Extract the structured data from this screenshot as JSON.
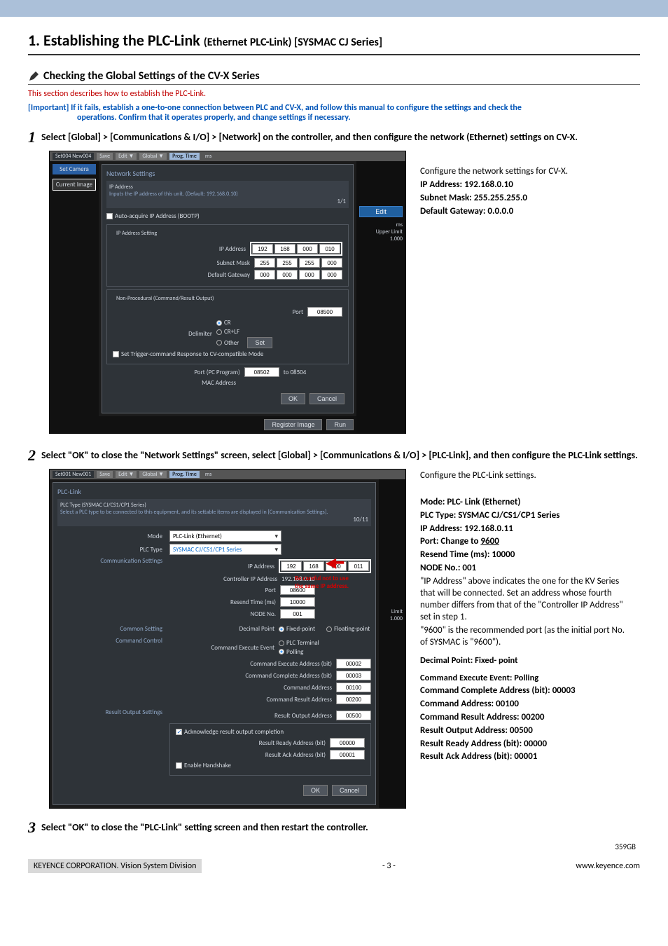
{
  "header": {
    "title_main": "1. Establishing the PLC-Link ",
    "title_sub": "(Ethernet PLC-Link) [SYSMAC CJ Series]"
  },
  "section": {
    "subtitle": "Checking the Global Settings of the CV-X Series",
    "desc": "This section describes how to establish the PLC-Link.",
    "important_a": "[Important] If it fails, establish a one-to-one connection between PLC and CV-X, and follow this manual to configure the settings and check the",
    "important_b": "operations. Confirm that it operates properly, and change settings if necessary."
  },
  "step1": {
    "num": "1",
    "text": "Select [Global] > [Communications & I/O] > [Network] on the controller, and then configure the network (Ethernet) settings on CV-X.",
    "notes": {
      "intro": "Configure the network settings for CV-X.",
      "ip": "IP Address: 192.168.0.10",
      "mask": "Subnet Mask: 255.255.255.0",
      "gw": "Default Gateway: 0.0.0.0"
    },
    "shot": {
      "topbar": {
        "set": "Set004 New004",
        "save": "Save",
        "edit": "Edit ▼",
        "global": "Global ▼",
        "prog": "Prog. Time",
        "ms": "ms"
      },
      "left": {
        "set_camera": "Set Camera",
        "current_image": "Current Image"
      },
      "panel_title": "Network Settings",
      "ip_hdr": "IP Address",
      "ip_hint": "Inputs the IP address of this unit. (Default: 192.168.0.10)",
      "counter": "1/1",
      "auto": "Auto-acquire IP Address (BOOTP)",
      "grp_ip": "IP Address Setting",
      "lbl_ip": "IP Address",
      "ip_vals": [
        "192",
        "168",
        "000",
        "010"
      ],
      "lbl_mask": "Subnet Mask",
      "mask_vals": [
        "255",
        "255",
        "255",
        "000"
      ],
      "lbl_gw": "Default Gateway",
      "gw_vals": [
        "000",
        "000",
        "000",
        "000"
      ],
      "grp_np": "Non-Procedural (Command/Result Output)",
      "lbl_port": "Port",
      "port": "08500",
      "lbl_delim": "Delimiter",
      "delim_cr": "CR",
      "delim_crlf": "CR+LF",
      "delim_other": "Other",
      "set_btn": "Set",
      "set_trigger": "Set Trigger-command Response to CV-compatible Mode",
      "lbl_portpc": "Port (PC Program)",
      "portpc_a": "08502",
      "portpc_to": "to 08504",
      "lbl_mac": "MAC Address",
      "ok": "OK",
      "cancel": "Cancel",
      "edit_btn": "Edit",
      "register": "Register Image",
      "run": "Run",
      "right": {
        "ms": "ms",
        "upper": "Upper Limit",
        "val": "1.000"
      }
    }
  },
  "step2": {
    "num": "2",
    "text": "Select \"OK\" to close the \"Network Settings\" screen, select [Global] > [Communications & I/O] > [PLC-Link], and then configure the PLC-Link settings.",
    "notes": {
      "intro": "Configure the PLC-Link settings.",
      "mode": "Mode: PLC- Link (Ethernet)",
      "plctype": "PLC Type: SYSMAC CJ/CS1/CP1 Series",
      "ip": "IP Address: 192.168.0.11",
      "port_pre": "Port: Change to ",
      "port_val": "9600",
      "resend": "Resend Time (ms): 10000",
      "node": "NODE No.: 001",
      "para1": "\"IP Address\" above indicates the one for the KV Series that will be connected. Set an address whose fourth number differs from that of the \"Controller IP Address\" set in step 1.",
      "para2": "\"9600\" is the recommended port (as the initial port No. of SYSMAC is \"9600\").",
      "dp": "Decimal Point: Fixed- point",
      "c_evt": "Command Execute Event: Polling",
      "c_caddr": "Command Complete Address (bit): 00003",
      "c_addr": "Command Address: 00100",
      "c_res": "Command Result Address: 00200",
      "r_out": "Result Output Address: 00500",
      "r_rdy": "Result Ready Address (bit): 00000",
      "r_ack": "Result Ack Address (bit): 00001"
    },
    "shot": {
      "topbar": {
        "set": "Set001 New001",
        "save": "Save",
        "edit": "Edit ▼",
        "global": "Global ▼",
        "prog": "Prog. Time",
        "ms": "ms"
      },
      "panel_title": "PLC-Link",
      "sub_hdr": "PLC Type (SYSMAC CJ/CS1/CP1 Series)",
      "sub_txt": "Select a PLC type to be connected to this equipment, and its settable items are displayed in [Communication Settings].",
      "counter": "10/11",
      "lbl_mode": "Mode",
      "mode_val": "PLC-Link (Ethernet)",
      "lbl_type": "PLC Type",
      "type_val": "SYSMAC CJ/CS1/CP1 Series",
      "sec_comm": "Communication Settings",
      "lbl_ip": "IP Address",
      "ip_vals": [
        "192",
        "168",
        "000",
        "011"
      ],
      "lbl_ctrlip": "Controller IP Address",
      "ctrlip": "192.168.0.10",
      "lbl_port": "Port",
      "port": "08600",
      "lbl_resend": "Resend Time (ms)",
      "resend": "10000",
      "lbl_node": "NODE No.",
      "node": "001",
      "warn1": "Be careful not to use",
      "warn2": "the same IP address.",
      "sec_common": "Common Setting",
      "lbl_dp": "Decimal Point",
      "dp_fixed": "Fixed-point",
      "dp_float": "Floating-point",
      "sec_cmd": "Command Control",
      "lbl_evt": "Command Execute Event",
      "evt_plc": "PLC Terminal",
      "evt_poll": "Polling",
      "lbl_exaddr": "Command Execute Address (bit)",
      "exaddr": "00002",
      "lbl_caddr": "Command Complete Address (bit)",
      "caddr": "00003",
      "lbl_cmdaddr": "Command Address",
      "cmdaddr": "00100",
      "lbl_resaddr": "Command Result Address",
      "resaddr": "00200",
      "sec_res": "Result Output Settings",
      "lbl_roaddr": "Result Output Address",
      "roaddr": "00500",
      "ack_grp": "Acknowledge result output completion",
      "lbl_rrdy": "Result Ready Address (bit)",
      "rrdy": "00000",
      "lbl_rack": "Result Ack Address (bit)",
      "rack": "00001",
      "lbl_hs": "Enable Handshake",
      "ok": "OK",
      "cancel": "Cancel",
      "right": {
        "limit": "Limit",
        "val": "1.000"
      }
    }
  },
  "step3": {
    "num": "3",
    "text": "Select \"OK\" to close the \"PLC-Link\" setting screen and then restart the controller."
  },
  "footer": {
    "small": "359GB",
    "left": "KEYENCE CORPORATION. Vision System Division",
    "center": "- 3 -",
    "right": "www.keyence.com"
  }
}
